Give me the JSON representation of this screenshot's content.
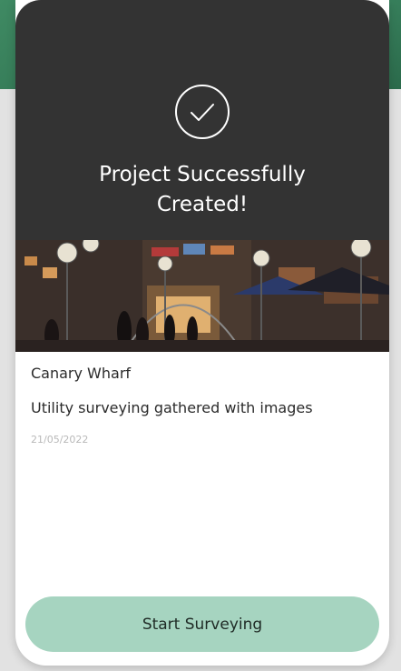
{
  "modal": {
    "title": "Project Successfully\nCreated!",
    "icon": "check-circle-icon"
  },
  "project": {
    "image": "canary-wharf-photo",
    "location": "Canary Wharf",
    "description": "Utility surveying gathered with images",
    "date": "21/05/2022"
  },
  "actions": {
    "start_label": "Start Surveying"
  },
  "colors": {
    "header_bg": "#333333",
    "button_bg": "#a6d4c0",
    "backdrop_green": "#2f7150"
  }
}
